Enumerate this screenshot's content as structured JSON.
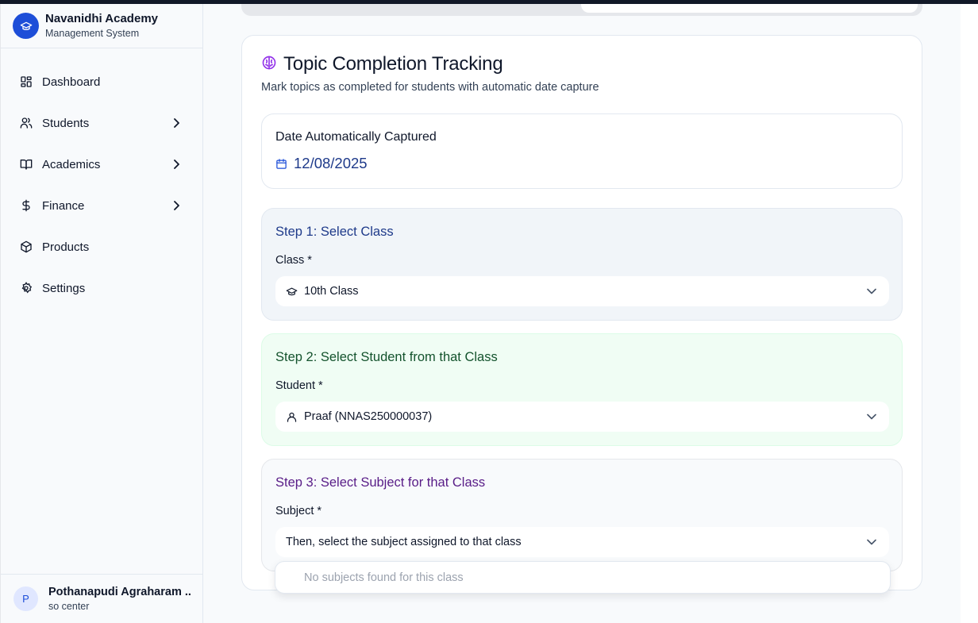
{
  "brand": {
    "title": "Navanidhi Academy",
    "subtitle": "Management System",
    "accent": "#1d4ed8"
  },
  "sidebar": {
    "items": [
      {
        "label": "Dashboard",
        "icon": "dashboard-icon",
        "has_submenu": false
      },
      {
        "label": "Students",
        "icon": "users-icon",
        "has_submenu": true
      },
      {
        "label": "Academics",
        "icon": "book-icon",
        "has_submenu": true
      },
      {
        "label": "Finance",
        "icon": "dollar-icon",
        "has_submenu": true
      },
      {
        "label": "Products",
        "icon": "package-icon",
        "has_submenu": false
      },
      {
        "label": "Settings",
        "icon": "gear-icon",
        "has_submenu": false
      }
    ]
  },
  "user": {
    "initial": "P",
    "name": "Pothanapudi Agraharam ...",
    "role": "so center"
  },
  "main": {
    "title": "Topic Completion Tracking",
    "title_icon": "brain-icon",
    "description": "Mark topics as completed for students with automatic date capture",
    "date": {
      "label": "Date Automatically Captured",
      "value": "12/08/2025"
    },
    "steps": [
      {
        "heading": "Step 1: Select Class",
        "field_label": "Class *",
        "value": "10th Class",
        "icon": "graduation-cap-icon",
        "color": "#1e3a8a"
      },
      {
        "heading": "Step 2: Select Student from that Class",
        "field_label": "Student *",
        "value": "Praaf (NNAS250000037)",
        "icon": "user-icon",
        "color": "#14532d"
      },
      {
        "heading": "Step 3: Select Subject for that Class",
        "field_label": "Subject *",
        "value": "Then, select the subject assigned to that class",
        "icon": "",
        "color": "#581c87"
      }
    ],
    "dropdown_empty": "No subjects found for this class"
  }
}
